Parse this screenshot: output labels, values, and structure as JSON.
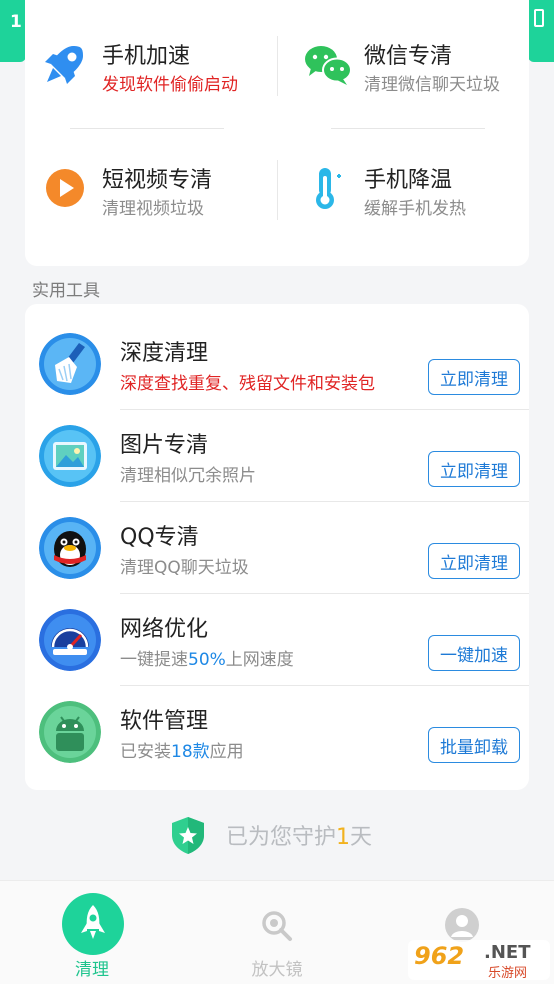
{
  "status": {
    "time_partial": "1"
  },
  "quick_actions": [
    {
      "title": "手机加速",
      "subtitle": "发现软件偷偷启动",
      "icon": "rocket-icon"
    },
    {
      "title": "微信专清",
      "subtitle": "清理微信聊天垃圾",
      "icon": "wechat-icon"
    },
    {
      "title": "短视频专清",
      "subtitle": "清理视频垃圾",
      "icon": "play-icon"
    },
    {
      "title": "手机降温",
      "subtitle": "缓解手机发热",
      "icon": "thermometer-icon"
    }
  ],
  "section_label": "实用工具",
  "tools": [
    {
      "title": "深度清理",
      "subtitle": "深度查找重复、残留文件和安装包",
      "button": "立即清理",
      "icon": "broom-icon"
    },
    {
      "title": "图片专清",
      "subtitle": "清理相似冗余照片",
      "button": "立即清理",
      "icon": "picture-icon"
    },
    {
      "title": "QQ专清",
      "subtitle": "清理QQ聊天垃圾",
      "button": "立即清理",
      "icon": "qq-penguin-icon"
    },
    {
      "title": "网络优化",
      "subtitle_pre": "一键提速",
      "subtitle_hl": "50%",
      "subtitle_post": "上网速度",
      "button": "一键加速",
      "icon": "speedometer-icon"
    },
    {
      "title": "软件管理",
      "subtitle_pre": "已安装",
      "subtitle_hl": "18款",
      "subtitle_post": "应用",
      "button": "批量卸载",
      "icon": "android-icon"
    }
  ],
  "protect": {
    "prefix": "已为您守护",
    "days": "1",
    "suffix": "天"
  },
  "nav": [
    {
      "label": "清理",
      "active": true
    },
    {
      "label": "放大镜",
      "active": false
    },
    {
      "label": "",
      "active": false
    }
  ],
  "watermark": {
    "brand": "962",
    "domain": ".NET",
    "cn": "乐游网"
  },
  "colors": {
    "accent": "#1ed39a",
    "link_blue": "#2b8be0",
    "warn_red": "#e02424",
    "gold": "#f2b21e"
  }
}
